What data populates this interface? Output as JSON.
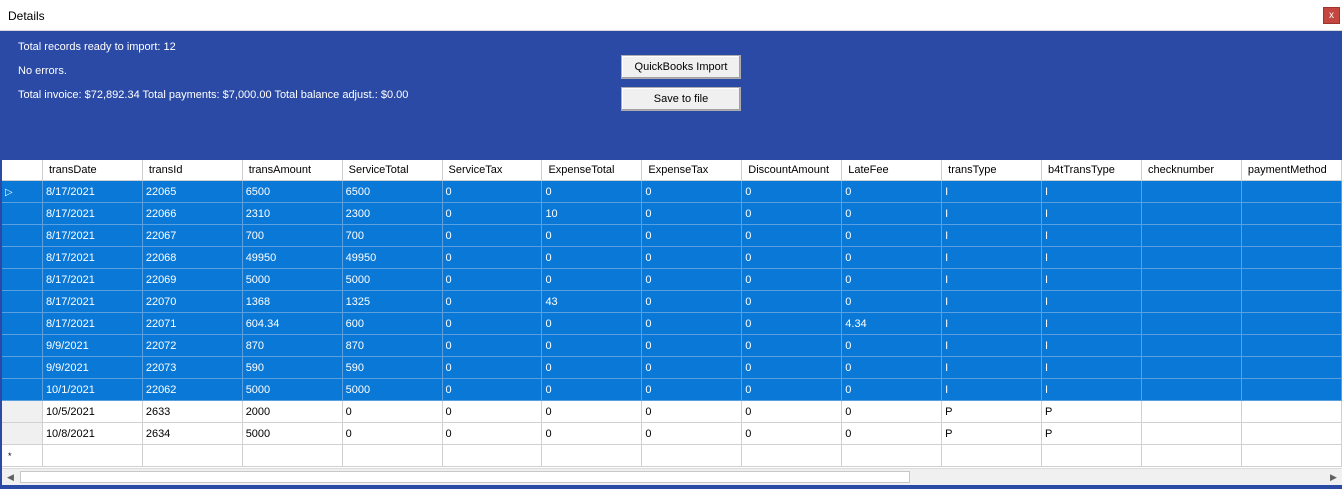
{
  "window": {
    "title": "Details",
    "close_label": "x"
  },
  "summary": {
    "records": "Total records ready to import: 12",
    "errors": "No errors.",
    "totals": "Total invoice: $72,892.34 Total payments: $7,000.00 Total balance adjust.: $0.00"
  },
  "buttons": {
    "import_label": "QuickBooks Import",
    "save_label": "Save to file"
  },
  "grid": {
    "columns": [
      "transDate",
      "transId",
      "transAmount",
      "ServiceTotal",
      "ServiceTax",
      "ExpenseTotal",
      "ExpenseTax",
      "DiscountAmount",
      "LateFee",
      "transType",
      "b4tTransType",
      "checknumber",
      "paymentMethod"
    ],
    "rows": [
      {
        "selected": true,
        "current": true,
        "cells": [
          "8/17/2021",
          "22065",
          "6500",
          "6500",
          "0",
          "0",
          "0",
          "0",
          "0",
          "I",
          "I",
          "",
          ""
        ]
      },
      {
        "selected": true,
        "cells": [
          "8/17/2021",
          "22066",
          "2310",
          "2300",
          "0",
          "10",
          "0",
          "0",
          "0",
          "I",
          "I",
          "",
          ""
        ]
      },
      {
        "selected": true,
        "cells": [
          "8/17/2021",
          "22067",
          "700",
          "700",
          "0",
          "0",
          "0",
          "0",
          "0",
          "I",
          "I",
          "",
          ""
        ]
      },
      {
        "selected": true,
        "cells": [
          "8/17/2021",
          "22068",
          "49950",
          "49950",
          "0",
          "0",
          "0",
          "0",
          "0",
          "I",
          "I",
          "",
          ""
        ]
      },
      {
        "selected": true,
        "cells": [
          "8/17/2021",
          "22069",
          "5000",
          "5000",
          "0",
          "0",
          "0",
          "0",
          "0",
          "I",
          "I",
          "",
          ""
        ]
      },
      {
        "selected": true,
        "cells": [
          "8/17/2021",
          "22070",
          "1368",
          "1325",
          "0",
          "43",
          "0",
          "0",
          "0",
          "I",
          "I",
          "",
          ""
        ]
      },
      {
        "selected": true,
        "cells": [
          "8/17/2021",
          "22071",
          "604.34",
          "600",
          "0",
          "0",
          "0",
          "0",
          "4.34",
          "I",
          "I",
          "",
          ""
        ]
      },
      {
        "selected": true,
        "cells": [
          "9/9/2021",
          "22072",
          "870",
          "870",
          "0",
          "0",
          "0",
          "0",
          "0",
          "I",
          "I",
          "",
          ""
        ]
      },
      {
        "selected": true,
        "cells": [
          "9/9/2021",
          "22073",
          "590",
          "590",
          "0",
          "0",
          "0",
          "0",
          "0",
          "I",
          "I",
          "",
          ""
        ]
      },
      {
        "selected": true,
        "cells": [
          "10/1/2021",
          "22062",
          "5000",
          "5000",
          "0",
          "0",
          "0",
          "0",
          "0",
          "I",
          "I",
          "",
          ""
        ]
      },
      {
        "selected": false,
        "cells": [
          "10/5/2021",
          "2633",
          "2000",
          "0",
          "0",
          "0",
          "0",
          "0",
          "0",
          "P",
          "P",
          "",
          ""
        ]
      },
      {
        "selected": false,
        "cells": [
          "10/8/2021",
          "2634",
          "5000",
          "0",
          "0",
          "0",
          "0",
          "0",
          "0",
          "P",
          "P",
          "",
          ""
        ]
      }
    ],
    "new_row_marker": "*",
    "current_row_marker": "▷"
  },
  "colors": {
    "panel": "#2a4aa6",
    "selection": "#0a78d7"
  }
}
